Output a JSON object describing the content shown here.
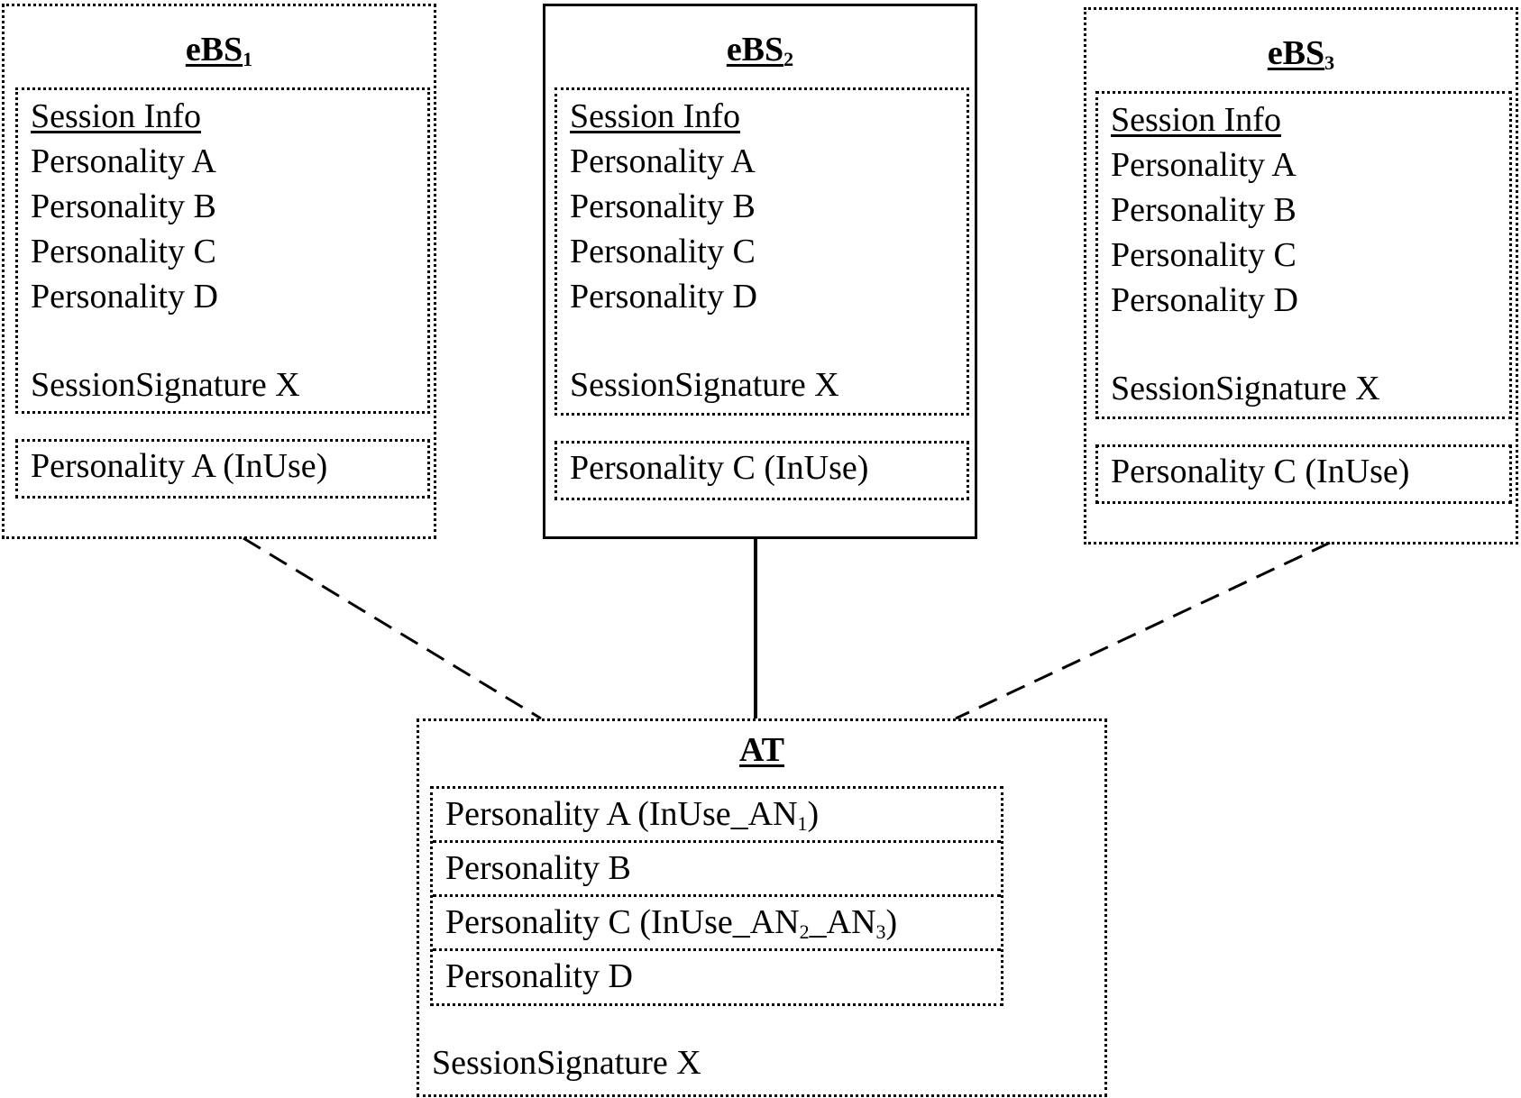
{
  "diagram": {
    "stations": [
      {
        "name": "eBS",
        "subscript": "1",
        "border": "dotted",
        "session_heading": "Session Info",
        "personalities": [
          "Personality A",
          "Personality B",
          "Personality C",
          "Personality D"
        ],
        "signature": "SessionSignature X",
        "in_use": "Personality A (InUse)",
        "link_style": "dashed"
      },
      {
        "name": "eBS",
        "subscript": "2",
        "border": "solid",
        "session_heading": "Session Info",
        "personalities": [
          "Personality A",
          "Personality B",
          "Personality C",
          "Personality D"
        ],
        "signature": "SessionSignature X",
        "in_use": "Personality C (InUse)",
        "link_style": "solid"
      },
      {
        "name": "eBS",
        "subscript": "3",
        "border": "dotted",
        "session_heading": "Session Info",
        "personalities": [
          "Personality A",
          "Personality B",
          "Personality C",
          "Personality D"
        ],
        "signature": "SessionSignature X",
        "in_use": "Personality C (InUse)",
        "link_style": "dashed"
      }
    ],
    "terminal": {
      "title": "AT",
      "rows": [
        {
          "text": "Personality A (InUse_AN",
          "sub": "1",
          "text2": ")",
          "sub2": "",
          "text3": ""
        },
        {
          "text": "Personality B",
          "sub": "",
          "text2": "",
          "sub2": "",
          "text3": ""
        },
        {
          "text": "Personality C (InUse_AN",
          "sub": "2",
          "text2": "_AN",
          "sub2": "3",
          "text3": ")"
        },
        {
          "text": "Personality D",
          "sub": "",
          "text2": "",
          "sub2": "",
          "text3": ""
        }
      ],
      "signature": "SessionSignature X"
    }
  }
}
